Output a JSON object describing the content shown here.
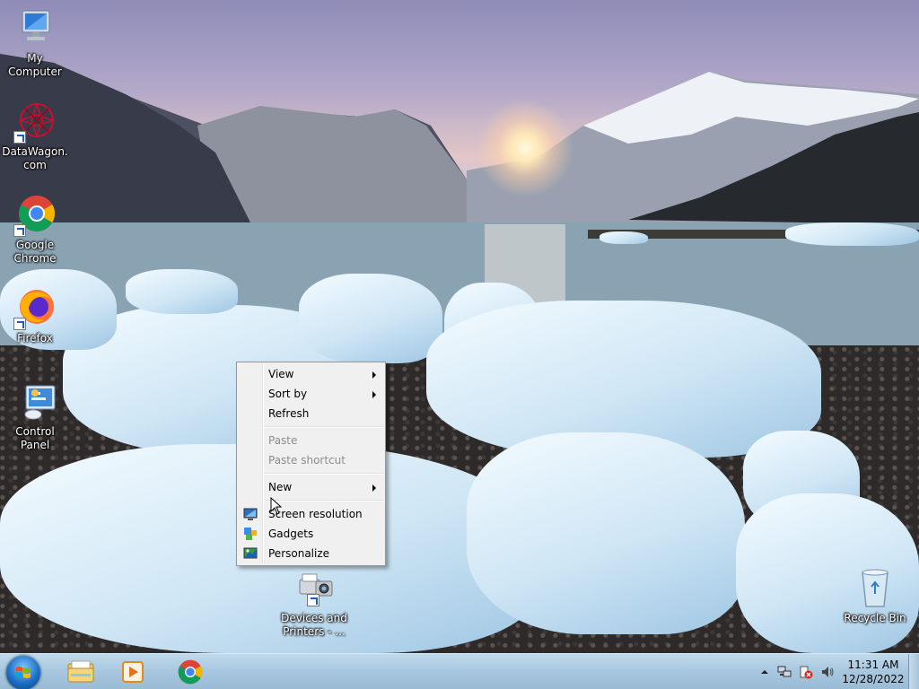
{
  "desktop": {
    "icons": [
      {
        "label": "My Computer",
        "icon": "computer-icon"
      },
      {
        "label": "DataWagon.com",
        "icon": "datawagon-icon"
      },
      {
        "label": "Google Chrome",
        "icon": "chrome-icon"
      },
      {
        "label": "Firefox",
        "icon": "firefox-icon"
      },
      {
        "label": "Control Panel",
        "icon": "control-panel-icon"
      },
      {
        "label": "Devices and Printers - ...",
        "icon": "devices-printers-icon"
      },
      {
        "label": "Recycle Bin",
        "icon": "recycle-bin-icon"
      }
    ]
  },
  "context_menu": {
    "view": "View",
    "sort_by": "Sort by",
    "refresh": "Refresh",
    "paste": "Paste",
    "paste_shortcut": "Paste shortcut",
    "new": "New",
    "screen_resolution": "Screen resolution",
    "gadgets": "Gadgets",
    "personalize": "Personalize"
  },
  "taskbar": {
    "pinned": [
      "windows-explorer-icon",
      "media-player-icon",
      "chrome-icon"
    ],
    "tray_icons": [
      "show-hidden-icons",
      "network-icon",
      "action-center-icon",
      "volume-icon"
    ],
    "time": "11:31 AM",
    "date": "12/28/2022"
  },
  "colors": {
    "menu_bg": "#f0f0f0",
    "taskbar": "#a9c8e0",
    "disabled_text": "#8d8d8d"
  }
}
